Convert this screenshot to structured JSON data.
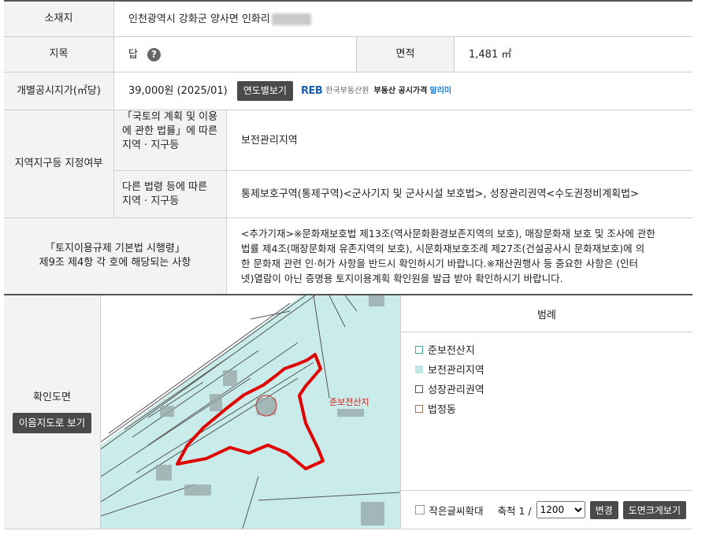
{
  "location": {
    "label": "소재지",
    "value": "인천광역시 강화군 양사면 인화리"
  },
  "jimok": {
    "label": "지목",
    "value": "답",
    "help_icon": "question-icon",
    "area_label": "면적",
    "area_value": "1,481 ㎡"
  },
  "price": {
    "label": "개별공시지가(㎡당)",
    "value": "39,000원 (2025/01)",
    "yearly_button": "연도별보기",
    "reb_logo": "REB",
    "reb_org": "한국부동산원",
    "reb_service": "부동산 공시가격",
    "reb_app": "알리미"
  },
  "zoning": {
    "label": "지역지구등 지정여부",
    "law1_label_lines": [
      "「국토의 계획 및 이용",
      "에 관한 법률」에 따른",
      "지역 · 지구등"
    ],
    "law1_value": "보전관리지역",
    "law2_label_lines": [
      "다른 법령 등에 따른",
      "지역 · 지구등"
    ],
    "law2_value": "통제보호구역(통제구역)<군사기지 및 군사시설 보호법>, 성장관리권역<수도권정비계획법>"
  },
  "regulation": {
    "label_lines": [
      "「토지이용규제 기본법 시행령」",
      "제9조 제4항 각 호에 해당되는 사항"
    ],
    "value_lines": [
      "<추가기재>※문화재보호법 제13조(역사문화환경보존지역의 보호), 매장문화재 보호 및 조사에 관한",
      "법률 제4조(매장문화재 유존지역의 보호), 시문화재보호조례 제27조(건설공사시 문화재보호)에 의",
      "한 문화재 관련 인·허가 사항을 반드시 확인하시기 바랍니다.※재산권행사 등 중요한 사항은 (인터",
      "넷)열람이 아닌 증명용 토지이용계획 확인원을 발급 받아 확인하시기 바랍니다."
    ]
  },
  "map": {
    "label": "확인도면",
    "view_button": "이음지도로 보기",
    "map_label": "준보전산지",
    "legend_title": "범례",
    "legend": [
      {
        "label": "준보전산지",
        "border": "#3aa89a",
        "fill": "#ffffff"
      },
      {
        "label": "보전관리지역",
        "border": "#bfe6e3",
        "fill": "#bfe6e3"
      },
      {
        "label": "성장관리권역",
        "border": "#555555",
        "fill": "#ffffff"
      },
      {
        "label": "법정동",
        "border": "#a0785a",
        "fill": "#ffffff"
      }
    ],
    "small_text_label": "작은글씨확대",
    "scale_label": "축척 1 /",
    "scale_value": "1200",
    "change_button": "변경",
    "large_button": "도면크게보기",
    "colors": {
      "map_bg": "#c9ecea",
      "parcel_outline": "#e00000",
      "label_red": "#d0201a"
    }
  }
}
